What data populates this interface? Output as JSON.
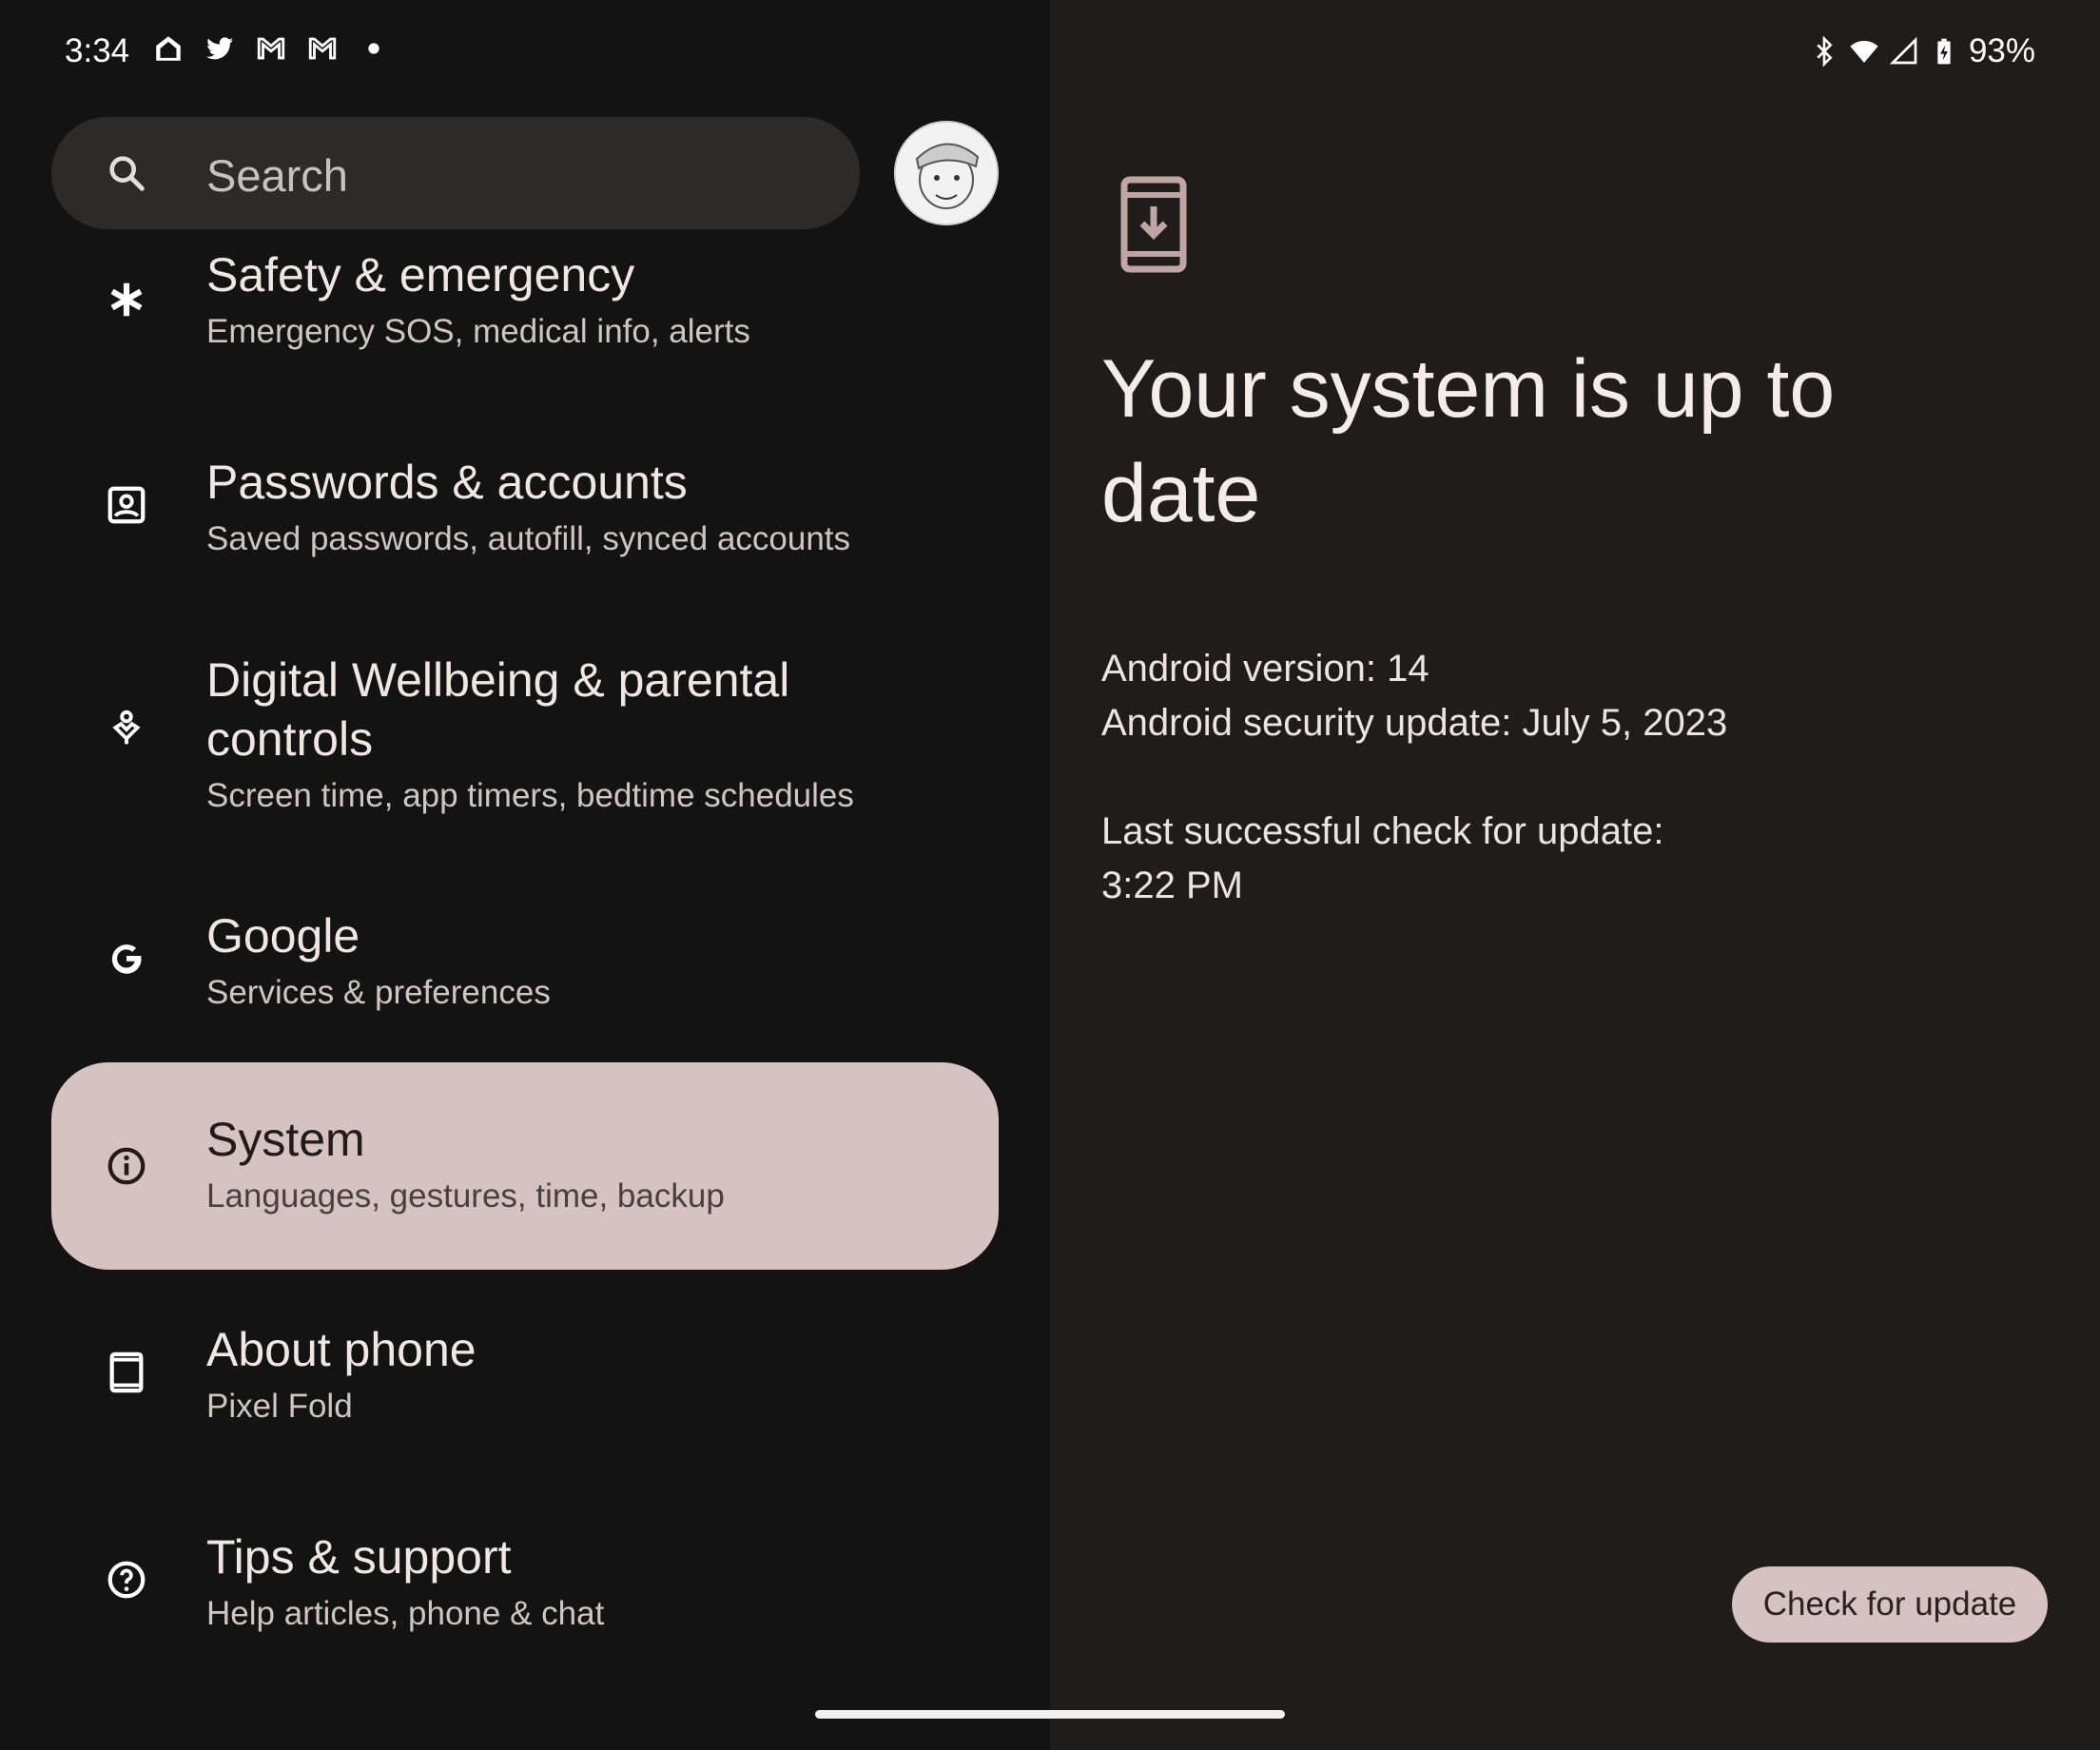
{
  "status_bar": {
    "time": "3:34",
    "battery": "93%",
    "notification_icons": [
      "home-icon",
      "twitter-icon",
      "gmail-icon",
      "gmail-icon",
      "dot-icon"
    ],
    "system_icons": [
      "bluetooth-icon",
      "wifi-icon",
      "signal-icon",
      "battery-charging-icon"
    ]
  },
  "search": {
    "placeholder": "Search"
  },
  "settings_list": [
    {
      "title": "Safety & emergency",
      "subtitle": "Emergency SOS, medical info, alerts",
      "icon": "asterisk-icon"
    },
    {
      "title": "Passwords & accounts",
      "subtitle": "Saved passwords, autofill, synced accounts",
      "icon": "account-box-icon"
    },
    {
      "title_line1": "Digital Wellbeing & parental",
      "title_line2": "controls",
      "subtitle": "Screen time, app timers, bedtime schedules",
      "icon": "wellbeing-icon"
    },
    {
      "title": "Google",
      "subtitle": "Services & preferences",
      "icon": "google-g-icon"
    },
    {
      "title": "System",
      "subtitle": "Languages, gestures, time, backup",
      "icon": "info-icon",
      "selected": true
    },
    {
      "title": "About phone",
      "subtitle": "Pixel Fold",
      "icon": "tablet-icon"
    },
    {
      "title": "Tips & support",
      "subtitle": "Help articles, phone & chat",
      "icon": "help-icon"
    }
  ],
  "detail": {
    "title_line1": "Your system is up to",
    "title_line2": "date",
    "android_version": "Android version: 14",
    "security_update": "Android security update: July 5, 2023",
    "last_check_label": "Last successful check for update:",
    "last_check_time": "3:22 PM",
    "check_button": "Check for update",
    "icon": "system-update-icon"
  },
  "colors": {
    "accent": "#d5c2c1",
    "left_bg": "#131313",
    "right_bg": "#201c1b"
  }
}
